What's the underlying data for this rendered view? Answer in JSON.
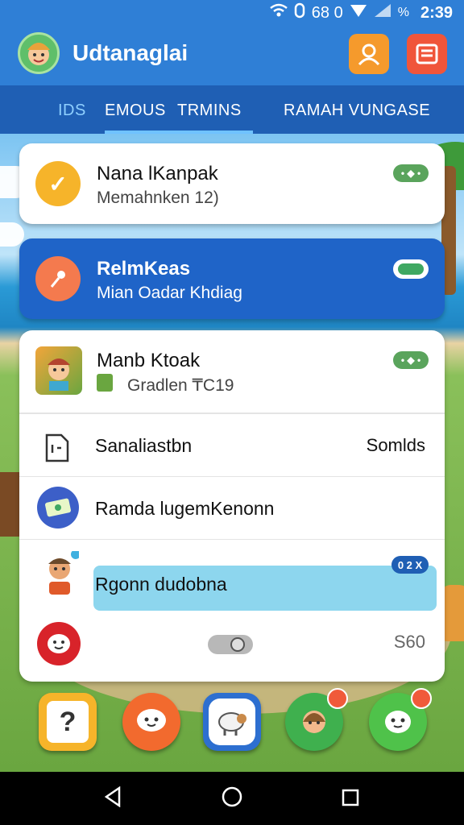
{
  "status_bar": {
    "icons": [
      "wifi-icon",
      "alarm-icon",
      "signal-icon",
      "battery-icon"
    ],
    "network": "68 0",
    "battery": "%",
    "time": "2:39"
  },
  "app_bar": {
    "title": "Udtanaglai",
    "avatar_icon": "cartoon-avatar-icon",
    "user_button_icon": "user-icon",
    "menu_button_icon": "list-icon"
  },
  "tabs": [
    {
      "label": "IDS"
    },
    {
      "label": "EMOUS"
    },
    {
      "label": "TRMINS"
    },
    {
      "label": "RAMAH VUNGASE"
    }
  ],
  "cards": {
    "card1": {
      "title": "Nana lKanpak",
      "subtitle": "Memahnken 12)",
      "badge": "• ◆ •",
      "icon": "check-icon"
    },
    "card2": {
      "title": "RelmKeas",
      "subtitle": "Mian Oadar Khdiag",
      "icon": "pin-icon",
      "toggle_on": true
    },
    "card3": {
      "title": "Manb Ktoak",
      "subtitle": "Gradlen ₸C19",
      "badge": "• ◆ •"
    }
  },
  "list": [
    {
      "label": "Sanaliastbn",
      "value": "Somlds",
      "icon": "document-icon"
    },
    {
      "label": "Ramda lugemKenonn",
      "value": "",
      "icon": "ticket-icon"
    },
    {
      "label": "Rgonn dudobna",
      "value": "",
      "badge": "0 2 X",
      "icon": "person-icon"
    },
    {
      "label": "",
      "value": "S60",
      "icon": "face-icon",
      "toggle_on": false
    }
  ],
  "dock": [
    {
      "name": "dock-app-chat",
      "icon": "?",
      "color": "#f6b42a"
    },
    {
      "name": "dock-app-messenger",
      "icon": "☻",
      "color": "#f26a2e"
    },
    {
      "name": "dock-app-sheep",
      "icon": "🐑",
      "color": "#2d6fd0"
    },
    {
      "name": "dock-app-contact",
      "icon": "☺",
      "color": "#3fb04e"
    },
    {
      "name": "dock-app-social",
      "icon": "☺",
      "color": "#4fc24a"
    }
  ],
  "colors": {
    "primary": "#2f7fd6",
    "tab_bar": "#1f5fb4",
    "selected_card": "#1f64c8",
    "badge_green": "#5aa45c",
    "highlight": "#8dd6ee"
  }
}
